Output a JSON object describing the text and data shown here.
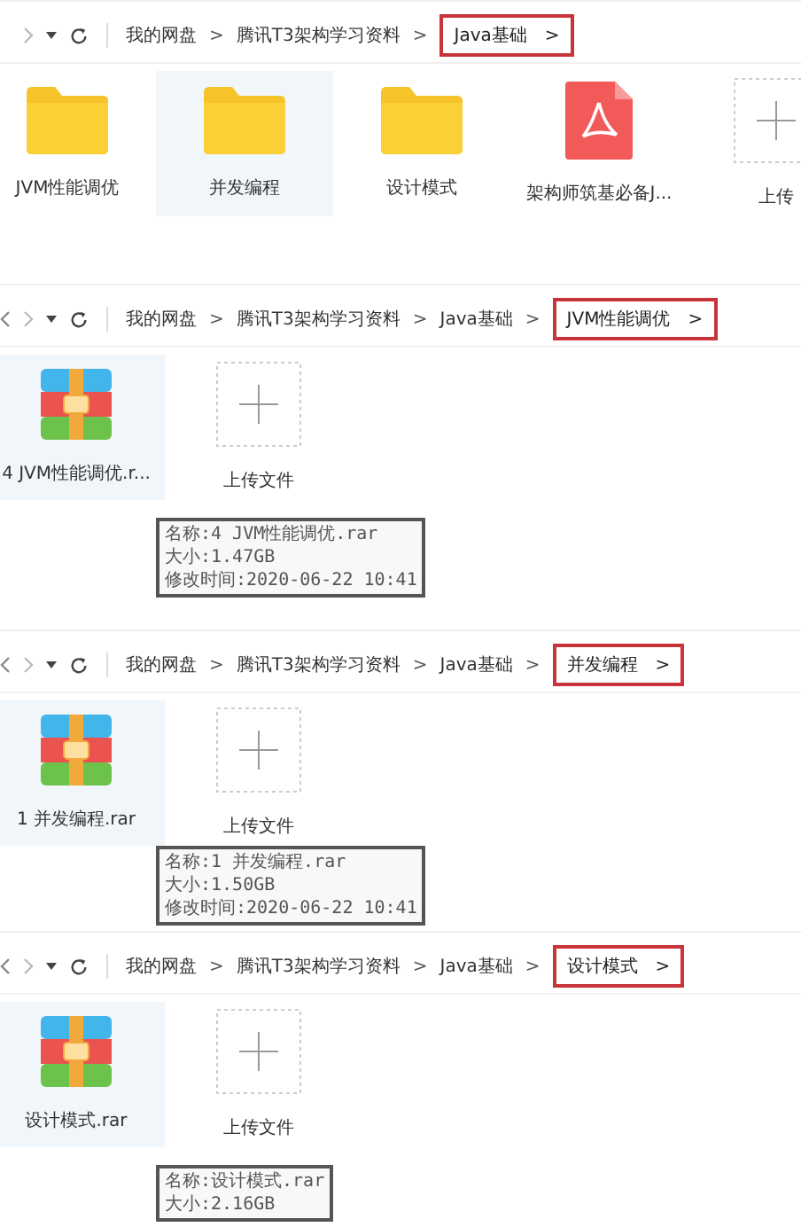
{
  "panels": [
    {
      "nav": [
        {
          "kind": "forward"
        },
        {
          "kind": "dropdown"
        },
        {
          "kind": "refresh"
        }
      ],
      "crumbs": [
        {
          "label": "我的网盘",
          "separator": ">",
          "highlighted": false
        },
        {
          "label": "腾讯T3架构学习资料",
          "separator": ">",
          "highlighted": false
        },
        {
          "label": "Java基础",
          "separator": ">",
          "highlighted": true
        }
      ],
      "items": [
        {
          "kind": "folder",
          "name": "JVM性能调优",
          "selected": false
        },
        {
          "kind": "folder",
          "name": "并发编程",
          "selected": true
        },
        {
          "kind": "folder",
          "name": "设计模式",
          "selected": false
        },
        {
          "kind": "pdf",
          "name": "架构师筑基必备J...",
          "selected": false
        },
        {
          "kind": "upload",
          "name": "上传",
          "selected": false
        }
      ]
    },
    {
      "nav": [
        {
          "kind": "back"
        },
        {
          "kind": "forward"
        },
        {
          "kind": "dropdown"
        },
        {
          "kind": "refresh"
        }
      ],
      "crumbs": [
        {
          "label": "我的网盘",
          "separator": ">",
          "highlighted": false
        },
        {
          "label": "腾讯T3架构学习资料",
          "separator": ">",
          "highlighted": false
        },
        {
          "label": "Java基础",
          "separator": ">",
          "highlighted": false
        },
        {
          "label": "JVM性能调优",
          "separator": ">",
          "highlighted": true
        }
      ],
      "items": [
        {
          "kind": "archive",
          "name": "4 JVM性能调优.r...",
          "selected": true
        },
        {
          "kind": "upload",
          "name": "上传文件",
          "selected": false
        }
      ],
      "tooltip": [
        "名称:4 JVM性能调优.rar",
        "大小:1.47GB",
        "修改时间:2020-06-22 10:41"
      ]
    },
    {
      "nav": [
        {
          "kind": "back"
        },
        {
          "kind": "forward"
        },
        {
          "kind": "dropdown"
        },
        {
          "kind": "refresh"
        }
      ],
      "crumbs": [
        {
          "label": "我的网盘",
          "separator": ">",
          "highlighted": false
        },
        {
          "label": "腾讯T3架构学习资料",
          "separator": ">",
          "highlighted": false
        },
        {
          "label": "Java基础",
          "separator": ">",
          "highlighted": false
        },
        {
          "label": "并发编程",
          "separator": ">",
          "highlighted": true
        }
      ],
      "items": [
        {
          "kind": "archive",
          "name": "1 并发编程.rar",
          "selected": true
        },
        {
          "kind": "upload",
          "name": "上传文件",
          "selected": false
        }
      ],
      "tooltip": [
        "名称:1 并发编程.rar",
        "大小:1.50GB",
        "修改时间:2020-06-22 10:41"
      ]
    },
    {
      "nav": [
        {
          "kind": "back"
        },
        {
          "kind": "forward"
        },
        {
          "kind": "dropdown"
        },
        {
          "kind": "refresh"
        }
      ],
      "crumbs": [
        {
          "label": "我的网盘",
          "separator": ">",
          "highlighted": false
        },
        {
          "label": "腾讯T3架构学习资料",
          "separator": ">",
          "highlighted": false
        },
        {
          "label": "Java基础",
          "separator": ">",
          "highlighted": false
        },
        {
          "label": "设计模式",
          "separator": ">",
          "highlighted": true
        }
      ],
      "items": [
        {
          "kind": "archive",
          "name": "设计模式.rar",
          "selected": true
        },
        {
          "kind": "upload",
          "name": "上传文件",
          "selected": false
        }
      ],
      "tooltip": [
        "名称:设计模式.rar",
        "大小:2.16GB"
      ]
    }
  ]
}
